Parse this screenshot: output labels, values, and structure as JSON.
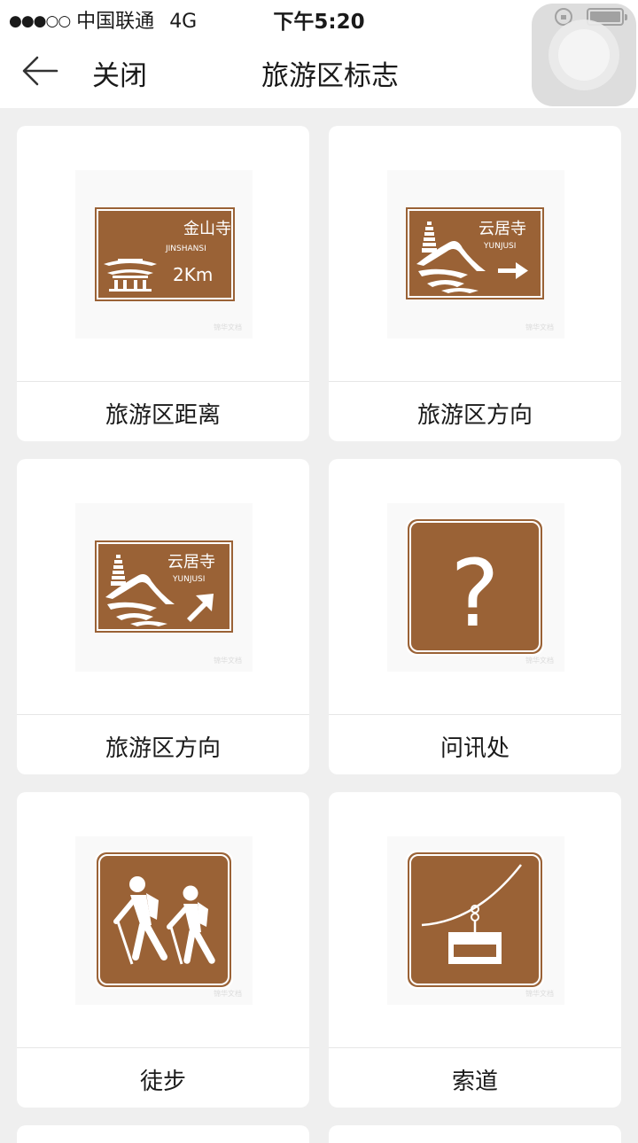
{
  "status_bar": {
    "signal": "●●●○○",
    "carrier": "中国联通",
    "network": "4G",
    "time": "下午5:20"
  },
  "nav": {
    "back_icon": "arrow-left-icon",
    "close_label": "关闭",
    "title": "旅游区标志"
  },
  "colors": {
    "sign_brown": "#9a6236",
    "sign_border": "#ffffff",
    "background": "#efefef"
  },
  "cards": [
    {
      "label": "旅游区距离",
      "sign": {
        "name_cn": "金山寺",
        "name_en": "JINSHANSI",
        "distance": "2Km",
        "icon": "temple-icon"
      }
    },
    {
      "label": "旅游区方向",
      "sign": {
        "name_cn": "云居寺",
        "name_en": "YUNJUSI",
        "icon": "pagoda-mountain-icon",
        "arrow": "arrow-right-icon"
      }
    },
    {
      "label": "旅游区方向",
      "sign": {
        "name_cn": "云居寺",
        "name_en": "YUNJUSI",
        "icon": "pagoda-mountain-icon",
        "arrow": "arrow-up-right-icon"
      }
    },
    {
      "label": "问讯处",
      "sign": {
        "symbol": "?",
        "icon": "question-mark-icon"
      }
    },
    {
      "label": "徒步",
      "sign": {
        "icon": "hikers-icon"
      }
    },
    {
      "label": "索道",
      "sign": {
        "icon": "cable-car-icon"
      }
    }
  ]
}
